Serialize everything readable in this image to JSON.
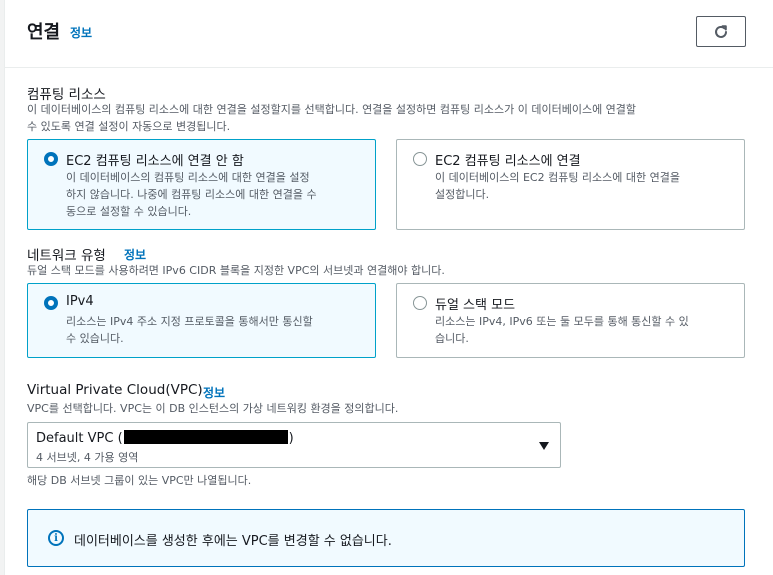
{
  "header": {
    "title": "연결",
    "info_label": "정보",
    "refresh_icon": "refresh-icon"
  },
  "compute": {
    "label": "컴퓨팅 리소스",
    "description_line1": "이 데이터베이스의 컴퓨팅 리소스에 대한 연결을 설정할지를 선택합니다. 연결을 설정하면 컴퓨팅 리소스가 이 데이터베이스에 연결할",
    "description_line2": "수 있도록 연결 설정이 자동으로 변경됩니다.",
    "options": [
      {
        "title": "EC2 컴퓨팅 리소스에 연결 안 함",
        "desc_lines": [
          "이 데이터베이스의 컴퓨팅 리소스에 대한 연결을 설정",
          "하지 않습니다. 나중에 컴퓨팅 리소스에 대한 연결을 수",
          "동으로 설정할 수 있습니다."
        ],
        "selected": true
      },
      {
        "title": "EC2 컴퓨팅 리소스에 연결",
        "desc_lines": [
          "이 데이터베이스의 EC2 컴퓨팅 리소스에 대한 연결을",
          "설정합니다."
        ],
        "selected": false
      }
    ]
  },
  "network": {
    "label": "네트워크 유형",
    "info_label": "정보",
    "description": "듀얼 스택 모드를 사용하려면 IPv6 CIDR 블록을 지정한 VPC의 서브넷과 연결해야 합니다.",
    "options": [
      {
        "title": "IPv4",
        "desc_lines": [
          "리소스는 IPv4 주소 지정 프로토콜을 통해서만 통신할",
          "수 있습니다."
        ],
        "selected": true
      },
      {
        "title": "듀얼 스택 모드",
        "desc_lines": [
          "리소스는 IPv4, IPv6 또는 둘 모두를 통해 통신할 수 있",
          "습니다."
        ],
        "selected": false
      }
    ]
  },
  "vpc": {
    "label": "Virtual Private Cloud(VPC)",
    "info_label": "정보",
    "description": "VPC를 선택합니다. VPC는 이 DB 인스턴스의 가상 네트워킹 환경을 정의합니다.",
    "selected_prefix": "Default VPC (",
    "selected_suffix": ")",
    "selected_sub": "4 서브넷, 4 가용 영역",
    "hint": "해당 DB 서브넷 그룹이 있는 VPC만 나열됩니다."
  },
  "alert": {
    "icon": "info-icon",
    "text": "데이터베이스를 생성한 후에는 VPC를 변경할 수 없습니다."
  },
  "colors": {
    "accent": "#0073bb",
    "selected_border": "#00a1c9",
    "selected_bg": "#f1faff"
  }
}
